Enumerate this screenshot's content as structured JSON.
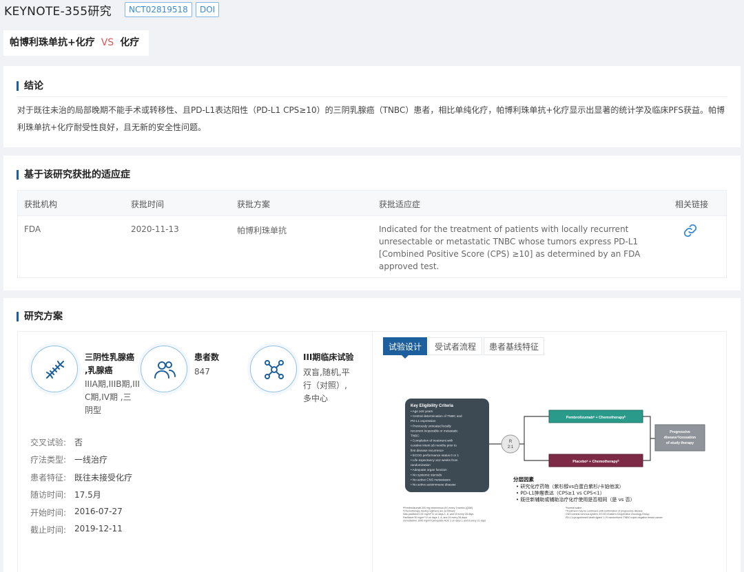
{
  "header": {
    "title": "KEYNOTE-355研究",
    "nct_tag": "NCT02819518",
    "doi_tag": "DOI"
  },
  "regimen": {
    "treatment": "帕博利珠单抗+化疗",
    "vs": "VS",
    "control": "化疗"
  },
  "conclusion": {
    "heading": "结论",
    "text": "对于既往未治的局部晚期不能手术或转移性、且PD-L1表达阳性（PD-L1 CPS≥10）的三阴乳腺癌（TNBC）患者，相比单纯化疗，帕博利珠单抗+化疗显示出显著的统计学及临床PFS获益。帕博利珠单抗+化疗耐受性良好，且无新的安全性问题。"
  },
  "indications": {
    "heading": "基于该研究获批的适应症",
    "columns": [
      "获批机构",
      "获批时间",
      "获批方案",
      "获批适应症",
      "相关链接"
    ],
    "rows": [
      {
        "agency": "FDA",
        "date": "2020-11-13",
        "regimen": "帕博利珠单抗",
        "indication": "Indicated for the treatment of patients with locally recurrent unresectable or metastatic TNBC whose tumors express PD-L1 [Combined Positive Score (CPS) ≥10] as determined by an FDA approved test.",
        "link_icon": "link-icon"
      }
    ]
  },
  "protocol": {
    "heading": "研究方案",
    "disease": {
      "icon": "dna-icon",
      "title": "三阴性乳腺癌,乳腺癌",
      "title_line1": "三阴性乳腺癌",
      "title_line2": ",乳腺癌",
      "stages": "IIIA期,IIIB期,IIIC期,IV期 ,三阴型",
      "stages_line1": "IIIA期,IIIB期,III",
      "stages_line2": "C期,IV期 ,三",
      "stages_line3": "阴型"
    },
    "patients": {
      "icon": "people-icon",
      "title": "患者数",
      "value": "847"
    },
    "trial": {
      "icon": "network-icon",
      "title": "III期临床试验",
      "desc": "双盲,随机,平行（对照）,多中心",
      "desc_line1": "双盲,随机,平",
      "desc_line2": "行（对照）,",
      "desc_line3": "多中心"
    },
    "details": [
      {
        "label": "交叉试验:",
        "value": "否"
      },
      {
        "label": "疗法类型:",
        "value": "一线治疗"
      },
      {
        "label": "患者特征:",
        "value": "既往未接受化疗"
      },
      {
        "label": "随访时间:",
        "value": "17.5月"
      },
      {
        "label": "开始时间:",
        "value": "2016-07-27"
      },
      {
        "label": "截止时间:",
        "value": "2019-12-11"
      }
    ],
    "tabs": [
      "试验设计",
      "受试者流程",
      "患者基线特征"
    ],
    "active_tab": "试验设计",
    "design": {
      "criteria_title": "Key Eligibility Criteria",
      "criteria": [
        "• Age ≥18 years",
        "• Central determination of TNBC and",
        "  PD-L1 expression",
        "• Previously untreated locally",
        "  recurrent inoperable or metastatic",
        "  TNBC",
        "• Completion of treatment with",
        "  curative intent ≥6 months prior to",
        "  first disease recurrence",
        "• ECOG performance status 0 or 1",
        "• Life expectancy ≥12 weeks from",
        "  randomization",
        "• Adequate organ function",
        "• No systemic steroids",
        "• No active CNS metastases",
        "• No active autoimmune disease"
      ],
      "randomization": "R",
      "ratio": "2:1",
      "arm1": "Pembrolizumabᵃ + Chemotherapyᵇ",
      "arm2": "Placeboᵃ + Chemotherapyᵇ",
      "outcome": "Progressive diseaseᶜ/cessation of study therapy",
      "outcome_l1": "Progressive",
      "outcome_l2": "diseaseᶜ/cessation",
      "outcome_l3": "of study therapy",
      "strat_title": "分层因素",
      "strat_items": [
        "研究化疗药物（紫杉醇vs白蛋白紫杉/卡铂他滨）",
        "PD-L1肿瘤表达（CPS≥1 vs CPS<1）",
        "既往新辅助或辅助治疗化疗使用是否相同（是 vs 否）"
      ],
      "footnotes_left": [
        "ᵃPembrolizumab 200 mg intravenous (IV) every 3 weeks (Q3W)",
        "ᵇChemotherapy dosing regimens are as follows:",
        "  Nab-paclitaxel 100 mg/m² IV on days 1, 8, and 15 every 28 days",
        "  Paclitaxel 90 mg/m² IV on days 1, 8, and 15 every 28 days",
        "  Gemcitabine 1000 mg/m²/carboplatin AUC 2 on days 1 and 8 every 21 days"
      ],
      "footnotes_right": [
        "ᵃNormal saline",
        "ᶜTreatment may be continued until confirmation of progressive disease",
        "CNS=central nervous system; ECOG=Eastern Cooperative Oncology Group;",
        "PD-L1=programmed death ligand 1; R=randomized; TNBC=triple-negative breast cancer"
      ]
    }
  },
  "colors": {
    "accent": "#1c5f9c",
    "tag_border": "#7fb6e4",
    "vs_red": "#e05656",
    "arm1": "#2a9b8a",
    "arm2": "#7c2a45",
    "criteria_box": "#3d4a54"
  }
}
